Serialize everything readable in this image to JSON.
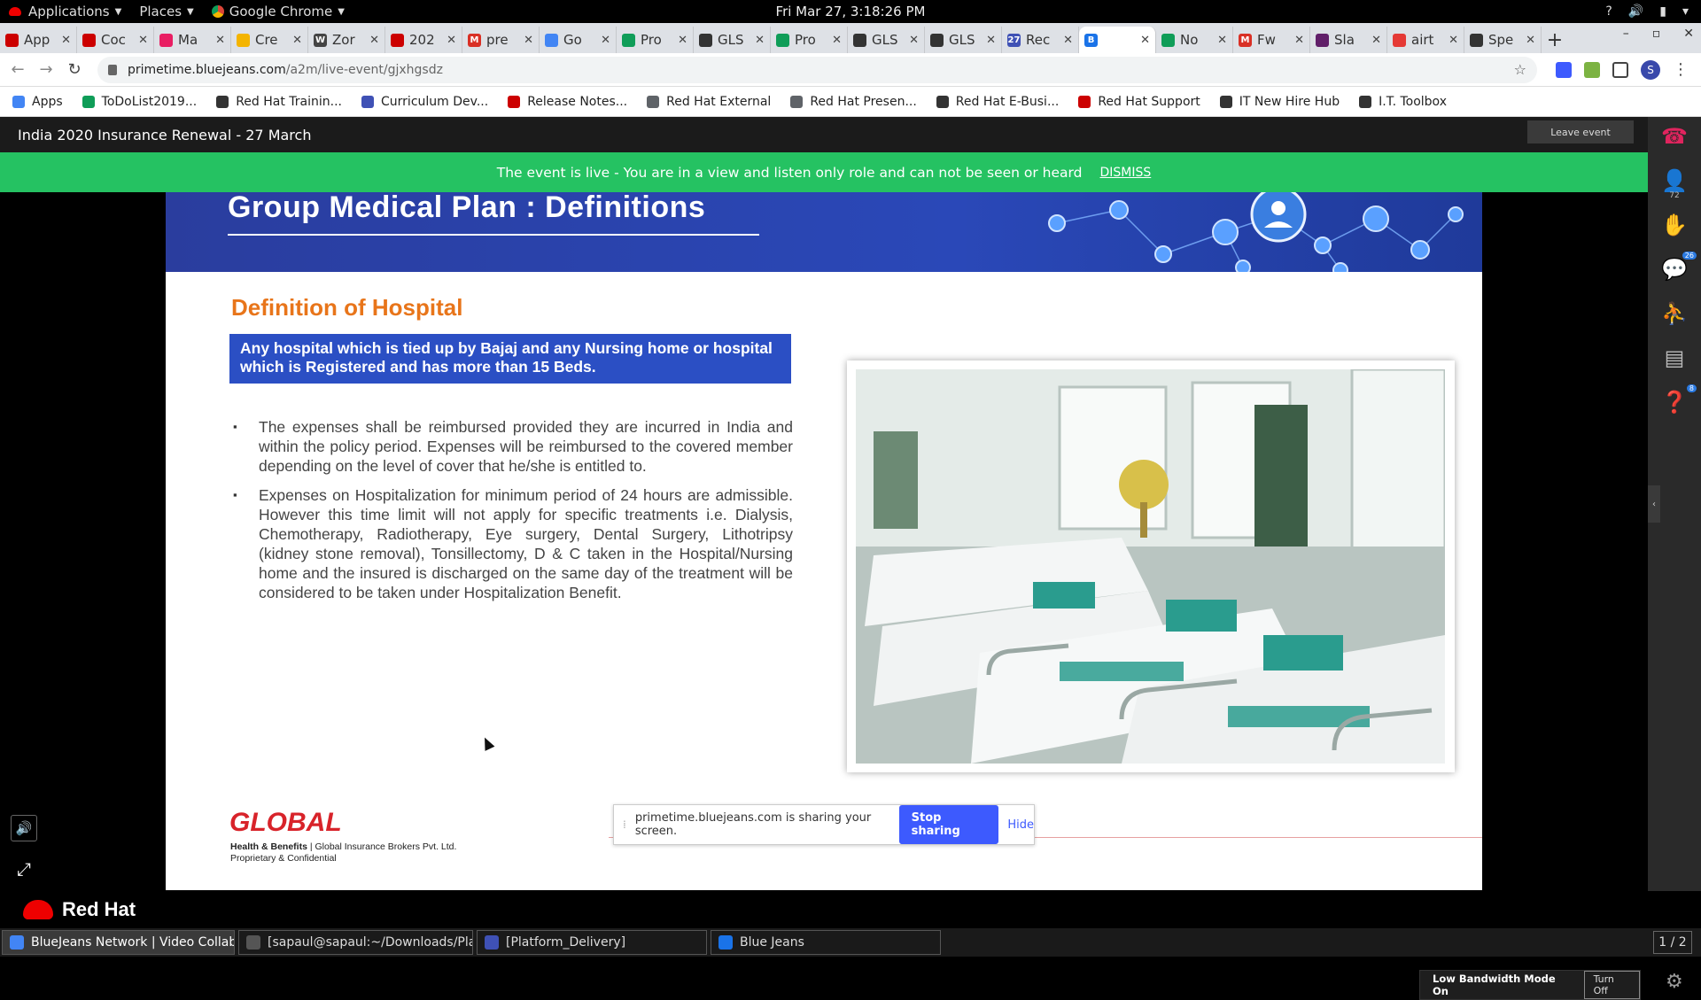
{
  "topbar": {
    "applications": "Applications",
    "places": "Places",
    "browser": "Google Chrome",
    "clock": "Fri Mar 27,  3:18:26 PM"
  },
  "tabs": [
    {
      "label": "App",
      "color": "#cc0000"
    },
    {
      "label": "Coc",
      "color": "#cc0000"
    },
    {
      "label": "Ma",
      "color": "#e91e63"
    },
    {
      "label": "Cre",
      "color": "#f4b400"
    },
    {
      "label": "Zor",
      "color": "#444444",
      "prefix": "W"
    },
    {
      "label": "202",
      "color": "#cc0000"
    },
    {
      "label": "pre",
      "color": "#d93025",
      "prefix": "M"
    },
    {
      "label": "Go",
      "color": "#4285f4"
    },
    {
      "label": "Pro",
      "color": "#0f9d58"
    },
    {
      "label": "GLS",
      "color": "#333333"
    },
    {
      "label": "Pro",
      "color": "#0f9d58"
    },
    {
      "label": "GLS",
      "color": "#333333"
    },
    {
      "label": "GLS",
      "color": "#333333"
    },
    {
      "label": "Rec",
      "color": "#3f51b5",
      "prefix": "27"
    },
    {
      "label": "",
      "color": "#1a73e8",
      "active": true,
      "prefix": "B"
    },
    {
      "label": "No",
      "color": "#0f9d58"
    },
    {
      "label": "Fw",
      "color": "#d93025",
      "prefix": "M"
    },
    {
      "label": "Sla",
      "color": "#611f69"
    },
    {
      "label": "airt",
      "color": "#e53935"
    },
    {
      "label": "Spe",
      "color": "#333333"
    }
  ],
  "address": {
    "host": "primetime.bluejeans.com",
    "path": "/a2m/live-event/gjxhgsdz"
  },
  "bookmarks": [
    {
      "label": "Apps",
      "color": "#4285f4"
    },
    {
      "label": "ToDoList2019...",
      "color": "#0f9d58"
    },
    {
      "label": "Red Hat Trainin...",
      "color": "#333333"
    },
    {
      "label": "Curriculum Dev...",
      "color": "#3f51b5"
    },
    {
      "label": "Release Notes...",
      "color": "#cc0000"
    },
    {
      "label": "Red Hat External",
      "color": "#5f6368"
    },
    {
      "label": "Red Hat Presen...",
      "color": "#5f6368"
    },
    {
      "label": "Red Hat E-Busi...",
      "color": "#333333"
    },
    {
      "label": "Red Hat Support",
      "color": "#cc0000"
    },
    {
      "label": "IT New Hire Hub",
      "color": "#333333"
    },
    {
      "label": "I.T. Toolbox",
      "color": "#333333"
    }
  ],
  "event": {
    "title": "India 2020 Insurance Renewal - 27 March",
    "leave": "Leave event",
    "banner": "The event is live - You are in a view and listen only role and can not be seen or heard",
    "dismiss": "DISMISS"
  },
  "sidebar": {
    "attendees": "72",
    "chat_badge": "26",
    "qa_badge": "8"
  },
  "slide": {
    "title": "Group Medical Plan : Definitions",
    "subtitle": "Definition of Hospital",
    "definition": "Any hospital which is tied up by Bajaj and any Nursing home or hospital which is Registered and has more than 15 Beds.",
    "bullets": [
      "The expenses shall be reimbursed provided they are incurred in India and within the policy period. Expenses will be reimbursed to the covered member depending on the level of cover that he/she is entitled to.",
      "Expenses on Hospitalization for minimum period of 24 hours are admissible.  However this time limit will not apply for specific treatments i.e. Dialysis, Chemotherapy, Radiotherapy, Eye surgery, Dental Surgery, Lithotripsy (kidney stone removal), Tonsillectomy, D & C taken in the Hospital/Nursing home and the insured is discharged on the same day of the treatment will be considered to be taken under Hospitalization Benefit."
    ],
    "logo": "GLOBAL",
    "logo_sub1_bold": "Health & Benefits",
    "logo_sub1_rest": " | Global Insurance Brokers Pvt. Ltd.",
    "logo_sub2": "Proprietary & Confidential"
  },
  "share": {
    "text": "primetime.bluejeans.com is sharing your screen.",
    "stop": "Stop sharing",
    "hide": "Hide"
  },
  "lowbw": {
    "label": "Low Bandwidth Mode On",
    "turnoff": "Turn Off"
  },
  "footer": {
    "brand": "Red Hat"
  },
  "taskbar": {
    "items": [
      {
        "label": "BlueJeans Network | Video Collab...",
        "active": true,
        "color": "#4285f4"
      },
      {
        "label": "[sapaul@sapaul:~/Downloads/Plat...",
        "active": false,
        "color": "#555555"
      },
      {
        "label": "[Platform_Delivery]",
        "active": false,
        "color": "#3f51b5"
      },
      {
        "label": "Blue Jeans",
        "active": false,
        "color": "#1a73e8"
      }
    ],
    "pager": "1 / 2"
  }
}
